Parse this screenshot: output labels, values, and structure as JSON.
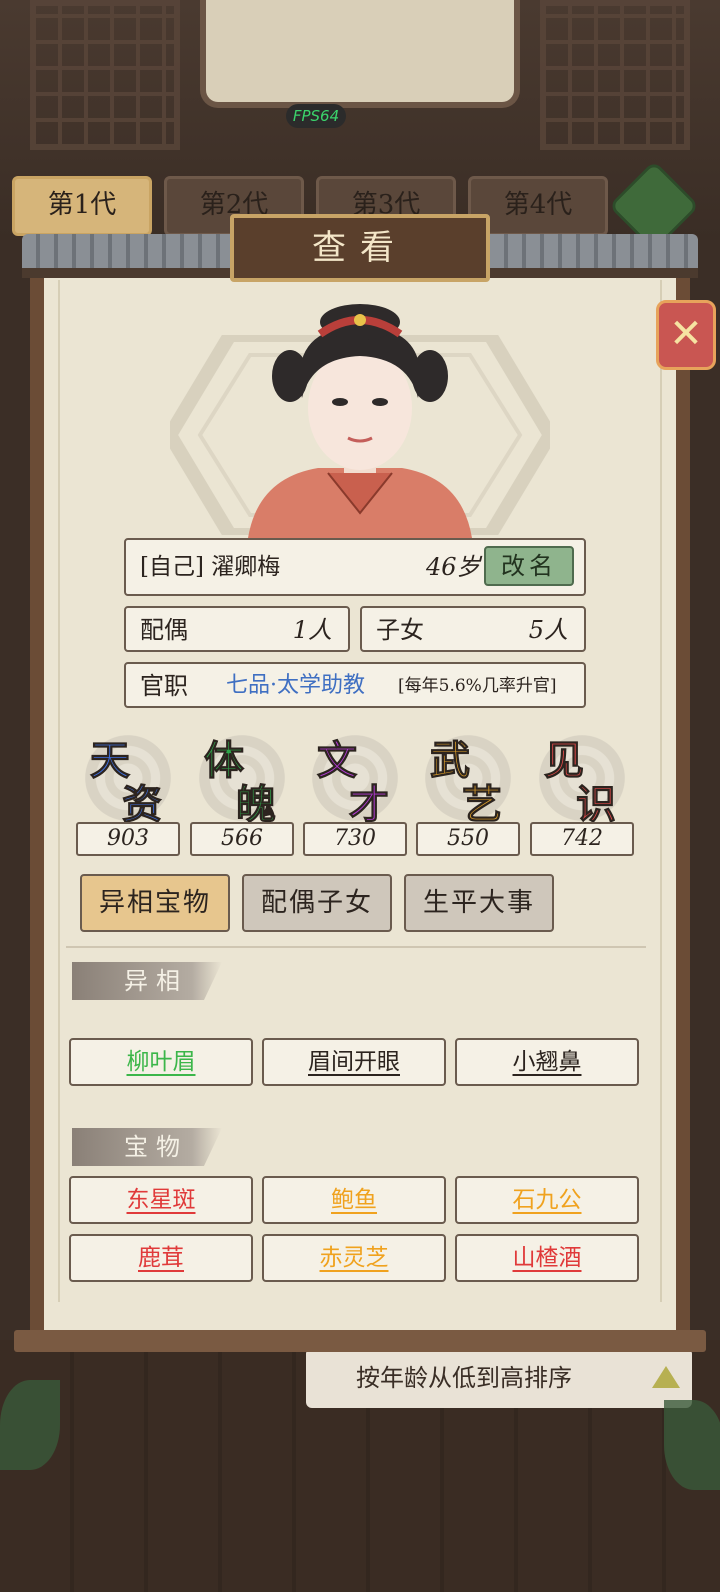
{
  "fps_label": "FPS64",
  "generation_tabs": [
    "第1代",
    "第2代",
    "第3代",
    "第4代"
  ],
  "sort_bar": {
    "label": "按年龄从低到高排序"
  },
  "dialog": {
    "title": "查看"
  },
  "profile": {
    "relation": "[自己]",
    "name": "濯卿梅",
    "age": "46岁",
    "rename_label": "改名",
    "spouse_label": "配偶",
    "spouse_count": "1人",
    "children_label": "子女",
    "children_count": "5人",
    "office_label": "官职",
    "office_title": "七品·太学助教",
    "office_rate": "[每年5.6%几率升官]"
  },
  "stats": [
    {
      "top": "天",
      "bottom": "资",
      "value": "903",
      "color": "#3d6fe0"
    },
    {
      "top": "体",
      "bottom": "魄",
      "value": "566",
      "color": "#2fa64a"
    },
    {
      "top": "文",
      "bottom": "才",
      "value": "730",
      "color": "#b23ad4"
    },
    {
      "top": "武",
      "bottom": "艺",
      "value": "550",
      "color": "#e0a12a"
    },
    {
      "top": "见",
      "bottom": "识",
      "value": "742",
      "color": "#e04a4a"
    }
  ],
  "tabs": [
    "异相宝物",
    "配偶子女",
    "生平大事"
  ],
  "sections": {
    "traits": {
      "title": "异相",
      "items": [
        {
          "label": "柳叶眉",
          "color": "#3cb64a"
        },
        {
          "label": "眉间开眼",
          "color": "#2c241f"
        },
        {
          "label": "小翘鼻",
          "color": "#2c241f"
        }
      ]
    },
    "treasures": {
      "title": "宝物",
      "items": [
        {
          "label": "东星斑",
          "color": "#e03a3a"
        },
        {
          "label": "鲍鱼",
          "color": "#f0a21e"
        },
        {
          "label": "石九公",
          "color": "#f0a21e"
        },
        {
          "label": "鹿茸",
          "color": "#e03a3a"
        },
        {
          "label": "赤灵芝",
          "color": "#f0a21e"
        },
        {
          "label": "山楂酒",
          "color": "#e03a3a"
        }
      ]
    }
  },
  "colors": {
    "accent_tab": "#e7c68e",
    "rename_button": "#8fb48d",
    "close_button": "#c95652"
  }
}
